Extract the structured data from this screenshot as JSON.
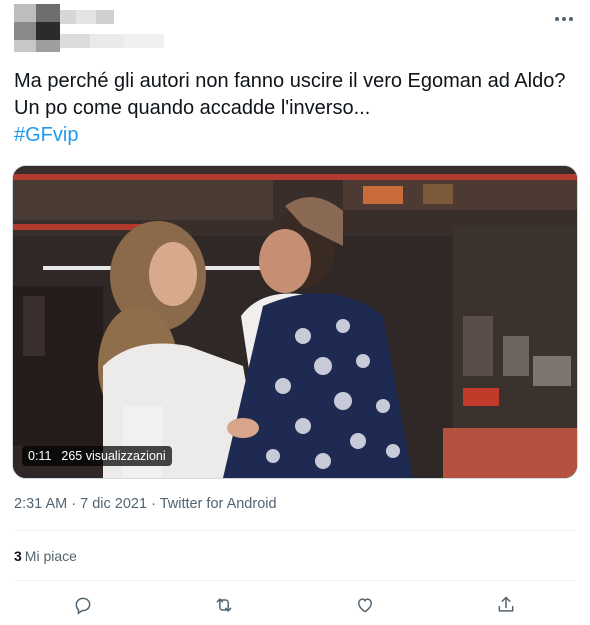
{
  "tweet": {
    "text": "Ma perché gli autori non fanno uscire il vero Egoman ad Aldo? Un po come quando accadde l'inverso...",
    "hashtag": "#GFvip"
  },
  "video": {
    "duration": "0:11",
    "views": "265 visualizzazioni"
  },
  "meta": {
    "time": "2:31 AM",
    "date": "7 dic 2021",
    "source": "Twitter for Android",
    "separator": "·"
  },
  "stats": {
    "likes_count": "3",
    "likes_label": "Mi piace"
  },
  "icons": {
    "more": "more-icon",
    "reply": "reply-icon",
    "retweet": "retweet-icon",
    "like": "heart-icon",
    "share": "share-icon"
  },
  "colors": {
    "accent": "#1d9bf0",
    "secondary_text": "#536471",
    "primary_text": "#0f1419"
  }
}
